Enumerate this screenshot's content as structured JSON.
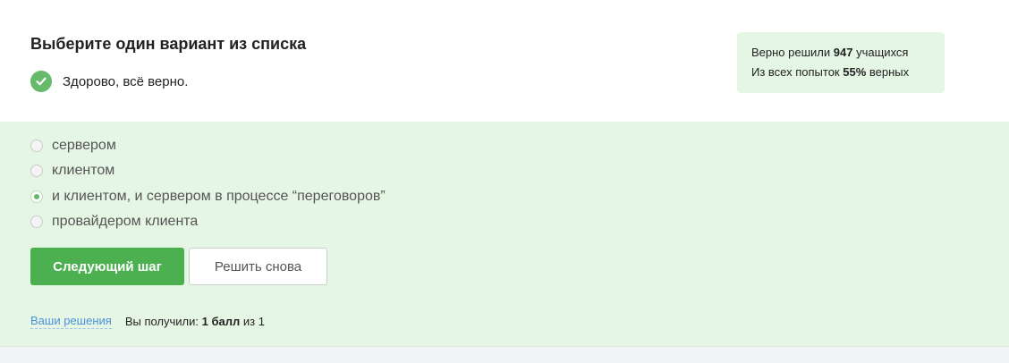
{
  "question": {
    "title": "Выберите один вариант из списка",
    "feedback": "Здорово, всё верно."
  },
  "stats": {
    "line1_prefix": "Верно решили",
    "solved_count": "947",
    "line1_suffix": "учащихся",
    "line2_prefix": "Из всех попыток",
    "percent": "55%",
    "line2_suffix": "верных"
  },
  "options": [
    {
      "label": "сервером",
      "selected": false
    },
    {
      "label": "клиентом",
      "selected": false
    },
    {
      "label": "и клиентом, и сервером в процессе “переговоров”",
      "selected": true
    },
    {
      "label": "провайдером клиента",
      "selected": false
    }
  ],
  "buttons": {
    "next": "Следующий шаг",
    "retry": "Решить снова"
  },
  "footer": {
    "solutions_link": "Ваши решения",
    "score_prefix": "Вы получили:",
    "score_value": "1 балл",
    "score_suffix": "из 1"
  },
  "colors": {
    "accent": "#4caf50",
    "success_bg": "#e6f6e4",
    "link": "#4a90d9"
  },
  "icons": {
    "feedback": "check-circle-icon"
  }
}
